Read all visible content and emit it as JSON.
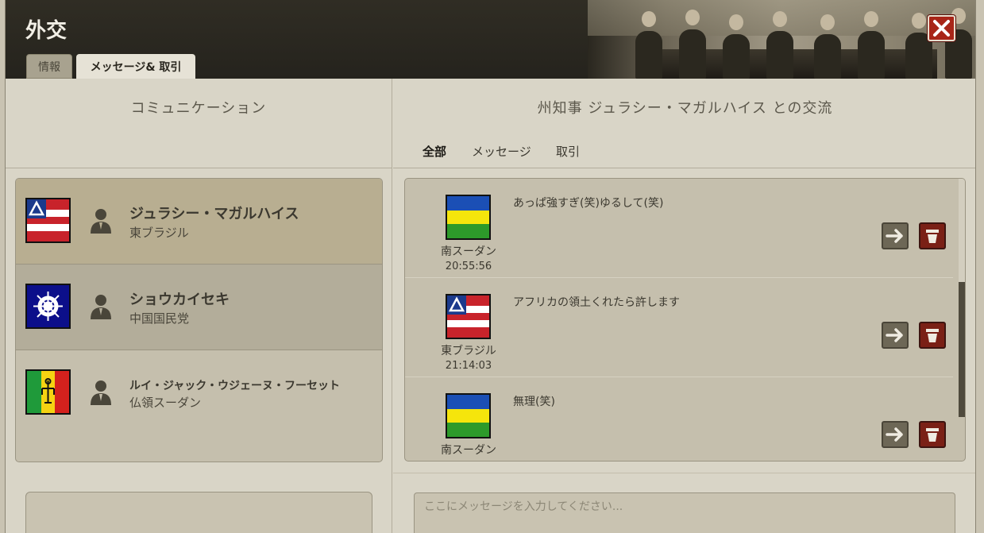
{
  "window": {
    "title": "外交",
    "tabs": [
      {
        "label": "情報"
      },
      {
        "label": "メッセージ& 取引"
      }
    ],
    "close_icon": "close-icon"
  },
  "left": {
    "title": "コミュニケーション",
    "contacts": [
      {
        "name": "ジュラシー・マガルハイス",
        "nation": "東ブラジル",
        "flag": "east-brazil-flag"
      },
      {
        "name": "ショウカイセキ",
        "nation": "中国国民党",
        "flag": "kmt-flag"
      },
      {
        "name": "ルイ・ジャック・ウジェーヌ・フーセット",
        "nation": "仏領スーダン",
        "flag": "french-sudan-flag"
      }
    ]
  },
  "right": {
    "title": "州知事 ジュラシー・マガルハイス との交流",
    "filters": [
      {
        "label": "全部"
      },
      {
        "label": "メッセージ"
      },
      {
        "label": "取引"
      }
    ],
    "messages": [
      {
        "nation": "南スーダン",
        "time": "20:55:56",
        "text": "あっぱ強すぎ(笑)ゆるして(笑)",
        "flag": "south-sudan-flag"
      },
      {
        "nation": "東ブラジル",
        "time": "21:14:03",
        "text": "アフリカの領土くれたら許します",
        "flag": "east-brazil-flag"
      },
      {
        "nation": "南スーダン",
        "time": "",
        "text": "無理(笑)",
        "flag": "south-sudan-flag"
      }
    ],
    "input_placeholder": "ここにメッセージを入力してください..."
  },
  "colors": {
    "header_bg": "#2b2820",
    "panel_bg": "#d9d5c7",
    "selected_contact": "#b8ae91",
    "close_red": "#a82518",
    "trash_red": "#7a2016"
  }
}
